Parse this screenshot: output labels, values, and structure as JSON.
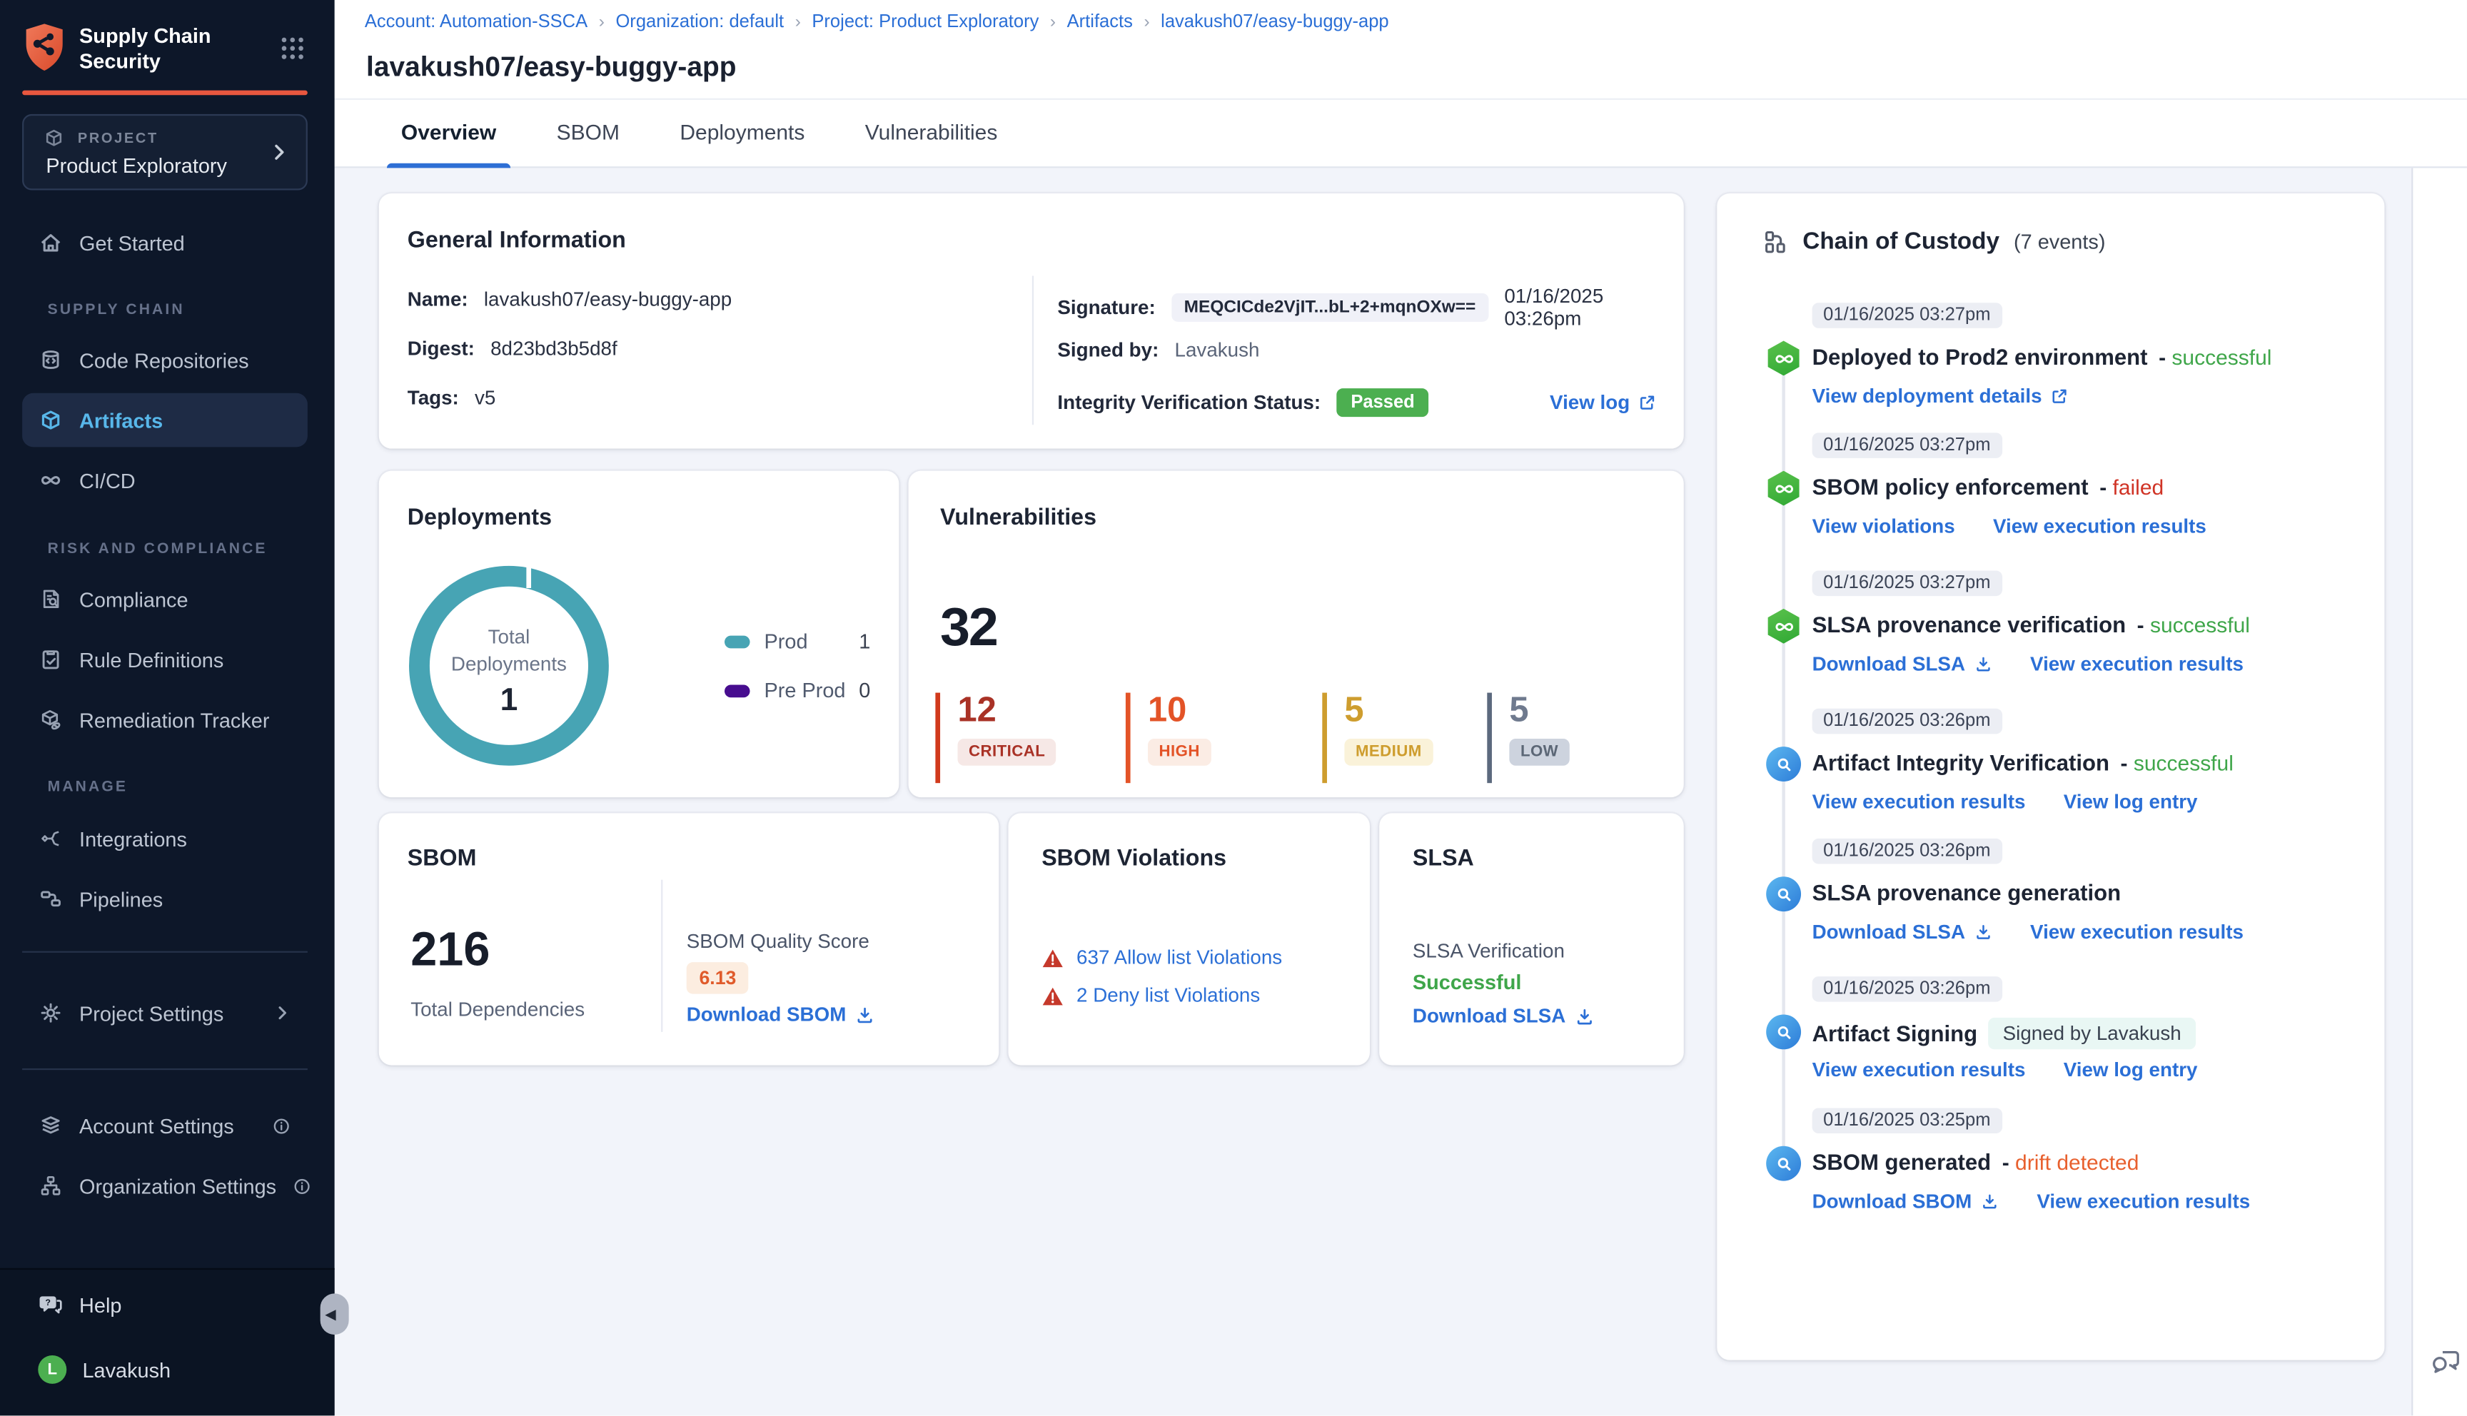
{
  "colors": {
    "accent_orange": "#E8573F",
    "link_blue": "#2B6FD6",
    "success_green": "#3FA64A",
    "fail_red": "#D03426",
    "drift_orange": "#E8602E",
    "prod_teal": "#47A4B4",
    "preprod_purple": "#470D8F",
    "passed_badge": "#4CAF50",
    "sidebar_bg": "#0D1729"
  },
  "sidebar": {
    "app_title": "Supply Chain Security",
    "project": {
      "label": "PROJECT",
      "name": "Product Exploratory"
    },
    "get_started": "Get Started",
    "sections": [
      {
        "label": "SUPPLY CHAIN",
        "items": [
          {
            "label": "Code Repositories"
          },
          {
            "label": "Artifacts"
          },
          {
            "label": "CI/CD"
          }
        ]
      },
      {
        "label": "RISK AND COMPLIANCE",
        "items": [
          {
            "label": "Compliance"
          },
          {
            "label": "Rule Definitions"
          },
          {
            "label": "Remediation Tracker"
          }
        ]
      },
      {
        "label": "MANAGE",
        "items": [
          {
            "label": "Integrations"
          },
          {
            "label": "Pipelines"
          }
        ]
      }
    ],
    "project_settings": "Project Settings",
    "account_settings": "Account Settings",
    "organization_settings": "Organization Settings",
    "help": "Help",
    "user": {
      "initial": "L",
      "name": "Lavakush"
    }
  },
  "header": {
    "breadcrumb": [
      "Account: Automation-SSCA",
      "Organization: default",
      "Project: Product Exploratory",
      "Artifacts",
      "lavakush07/easy-buggy-app"
    ],
    "title": "lavakush07/easy-buggy-app",
    "tabs": [
      {
        "label": "Overview"
      },
      {
        "label": "SBOM"
      },
      {
        "label": "Deployments"
      },
      {
        "label": "Vulnerabilities"
      }
    ]
  },
  "general_info": {
    "title": "General Information",
    "name_label": "Name:",
    "name": "lavakush07/easy-buggy-app",
    "digest_label": "Digest:",
    "digest": "8d23bd3b5d8f",
    "tags_label": "Tags:",
    "tags": "v5",
    "signature_label": "Signature:",
    "signature": "MEQCICde2VjIT...bL+2+mqnOXw==",
    "signature_date": "01/16/2025 03:26pm",
    "signed_by_label": "Signed by:",
    "signed_by": "Lavakush",
    "integrity_label": "Integrity Verification Status:",
    "integrity_status": "Passed",
    "view_log": "View log"
  },
  "deployments": {
    "title": "Deployments",
    "center_label": "Total Deployments",
    "total": "1",
    "legend": [
      {
        "label": "Prod",
        "value": "1",
        "color": "#47A4B4"
      },
      {
        "label": "Pre Prod",
        "value": "0",
        "color": "#470D8F"
      }
    ]
  },
  "vulnerabilities": {
    "title": "Vulnerabilities",
    "total": "32",
    "severities": [
      {
        "count": "12",
        "label": "CRITICAL"
      },
      {
        "count": "10",
        "label": "HIGH"
      },
      {
        "count": "5",
        "label": "MEDIUM"
      },
      {
        "count": "5",
        "label": "LOW"
      }
    ]
  },
  "sbom": {
    "title": "SBOM",
    "total": "216",
    "total_label": "Total Dependencies",
    "quality_label": "SBOM Quality Score",
    "quality_score": "6.13",
    "download": "Download SBOM"
  },
  "sbom_violations": {
    "title": "SBOM Violations",
    "items": [
      {
        "text": "637 Allow list Violations"
      },
      {
        "text": "2 Deny list Violations"
      }
    ]
  },
  "slsa": {
    "title": "SLSA",
    "verification_label": "SLSA Verification",
    "status": "Successful",
    "download": "Download SLSA"
  },
  "chain_of_custody": {
    "title": "Chain of Custody",
    "events_count": "(7 events)",
    "events": [
      {
        "time": "01/16/2025 03:27pm",
        "title": "Deployed to Prod2 environment",
        "status": "successful",
        "links": [
          {
            "label": "View deployment details"
          }
        ]
      },
      {
        "time": "01/16/2025 03:27pm",
        "title": "SBOM policy enforcement",
        "status": "failed",
        "links": [
          {
            "label": "View violations"
          },
          {
            "label": "View execution results"
          }
        ]
      },
      {
        "time": "01/16/2025 03:27pm",
        "title": "SLSA provenance verification",
        "status": "successful",
        "links": [
          {
            "label": "Download SLSA"
          },
          {
            "label": "View execution results"
          }
        ]
      },
      {
        "time": "01/16/2025 03:26pm",
        "title": "Artifact Integrity Verification",
        "status": "successful",
        "links": [
          {
            "label": "View execution results"
          },
          {
            "label": "View log entry"
          }
        ]
      },
      {
        "time": "01/16/2025 03:26pm",
        "title": "SLSA provenance generation",
        "status": "",
        "links": [
          {
            "label": "Download SLSA"
          },
          {
            "label": "View execution results"
          }
        ]
      },
      {
        "time": "01/16/2025 03:26pm",
        "title": "Artifact Signing",
        "status": "",
        "badge": "Signed by Lavakush",
        "links": [
          {
            "label": "View execution results"
          },
          {
            "label": "View log entry"
          }
        ]
      },
      {
        "time": "01/16/2025 03:25pm",
        "title": "SBOM generated",
        "status": "drift detected",
        "links": [
          {
            "label": "Download SBOM"
          },
          {
            "label": "View execution results"
          }
        ]
      }
    ]
  }
}
